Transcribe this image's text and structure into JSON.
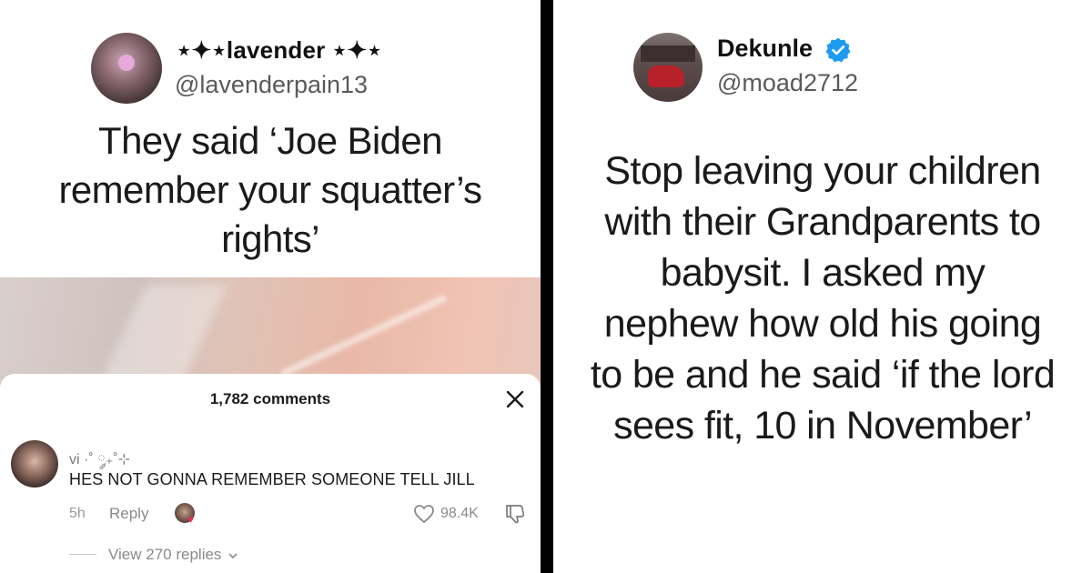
{
  "left_post": {
    "display_name": "⋆✦⋆lavender ⋆✦⋆",
    "handle": "@lavenderpain13",
    "text": "They said ‘Joe Biden remember your squatter’s rights’"
  },
  "comments_panel": {
    "count_label": "1,782 comments",
    "comment": {
      "author": "vi ·˚ ༘₊˚⊹",
      "text": "HES NOT GONNA REMEMBER SOMEONE TELL JILL",
      "time": "5h",
      "reply_label": "Reply",
      "likes": "98.4K",
      "view_replies_label": "View 270 replies"
    }
  },
  "right_post": {
    "display_name": "Dekunle",
    "handle": "@moad2712",
    "text": "Stop leaving your children with their Grandparents to babysit. I asked my nephew how old his going to be and he said ‘if the lord sees fit, 10 in November’",
    "verified": true
  },
  "colors": {
    "divider": "#000000",
    "verified_blue": "#1d9bf0",
    "heart_red": "#e8325a"
  },
  "icons": [
    "close-icon",
    "heart-icon",
    "dislike-icon",
    "chevron-down-icon",
    "verified-icon"
  ]
}
